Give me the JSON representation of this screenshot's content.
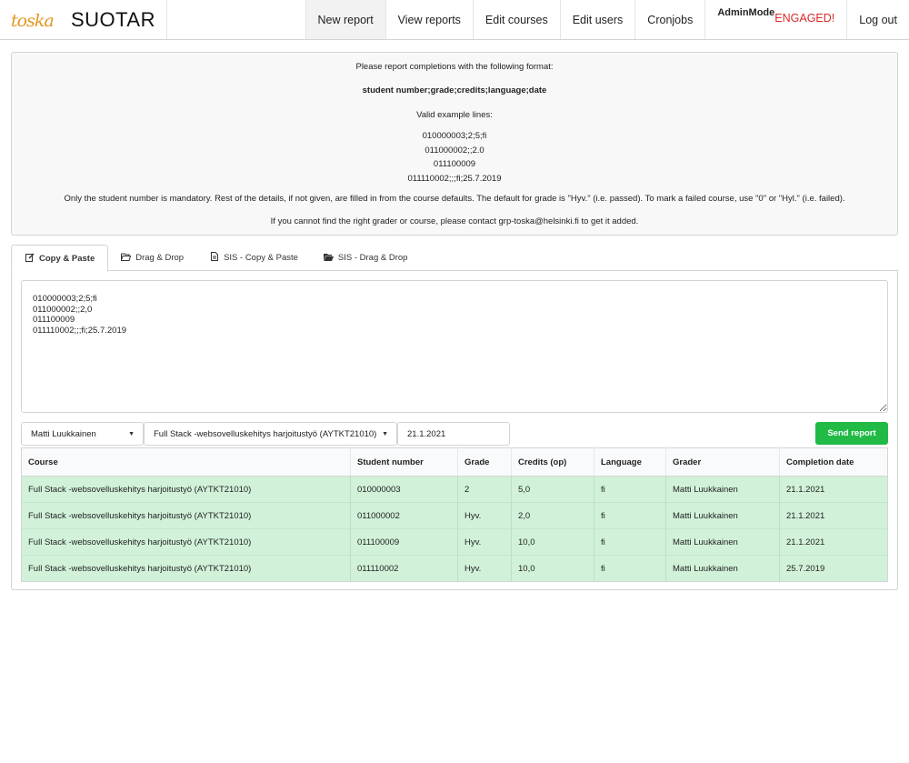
{
  "brand": {
    "logo_text": "toska",
    "title": "SUOTAR"
  },
  "nav": {
    "new_report": "New report",
    "view_reports": "View reports",
    "edit_courses": "Edit courses",
    "edit_users": "Edit users",
    "cronjobs": "Cronjobs",
    "admin_mode_label": "AdminMode",
    "admin_mode_value": "ENGAGED!",
    "logout": "Log out"
  },
  "instructions": {
    "intro": "Please report completions with the following format:",
    "format": "student number;grade;credits;language;date",
    "valid_heading": "Valid example lines:",
    "examples": [
      "010000003;2;5;fi",
      "011000002;;2.0",
      "011100009",
      "011110002;;;fi;25.7.2019"
    ],
    "mandatory_note": "Only the student number is mandatory. Rest of the details, if not given, are filled in from the course defaults. The default for grade is \"Hyv.\" (i.e. passed). To mark a failed course, use \"0\" or \"Hyl.\" (i.e. failed).",
    "contact_note": "If you cannot find the right grader or course, please contact grp-toska@helsinki.fi to get it added."
  },
  "tabs": [
    {
      "label": "Copy & Paste",
      "icon": "edit-icon",
      "active": true
    },
    {
      "label": "Drag & Drop",
      "icon": "folder-open-icon",
      "active": false
    },
    {
      "label": "SIS - Copy & Paste",
      "icon": "file-text-icon",
      "active": false
    },
    {
      "label": "SIS - Drag & Drop",
      "icon": "folder-open-solid-icon",
      "active": false
    }
  ],
  "report_input": {
    "value": "010000003;2;5;fi\n011000002;;2,0\n011100009\n011110002;;;fi;25.7.2019"
  },
  "controls": {
    "grader": "Matti Luukkainen",
    "course": "Full Stack -websovelluskehitys harjoitustyö (AYTKT21010)",
    "date": "21.1.2021",
    "send_label": "Send report"
  },
  "table": {
    "columns": [
      "Course",
      "Student number",
      "Grade",
      "Credits (op)",
      "Language",
      "Grader",
      "Completion date"
    ],
    "rows": [
      [
        "Full Stack -websovelluskehitys harjoitustyö (AYTKT21010)",
        "010000003",
        "2",
        "5,0",
        "fi",
        "Matti Luukkainen",
        "21.1.2021"
      ],
      [
        "Full Stack -websovelluskehitys harjoitustyö (AYTKT21010)",
        "011000002",
        "Hyv.",
        "2,0",
        "fi",
        "Matti Luukkainen",
        "21.1.2021"
      ],
      [
        "Full Stack -websovelluskehitys harjoitustyö (AYTKT21010)",
        "011100009",
        "Hyv.",
        "10,0",
        "fi",
        "Matti Luukkainen",
        "21.1.2021"
      ],
      [
        "Full Stack -websovelluskehitys harjoitustyö (AYTKT21010)",
        "011110002",
        "Hyv.",
        "10,0",
        "fi",
        "Matti Luukkainen",
        "25.7.2019"
      ]
    ]
  },
  "colors": {
    "accent": "#e3961f",
    "success": "#21ba45",
    "row_success": "#d1f2d9",
    "alert": "#db2828"
  }
}
